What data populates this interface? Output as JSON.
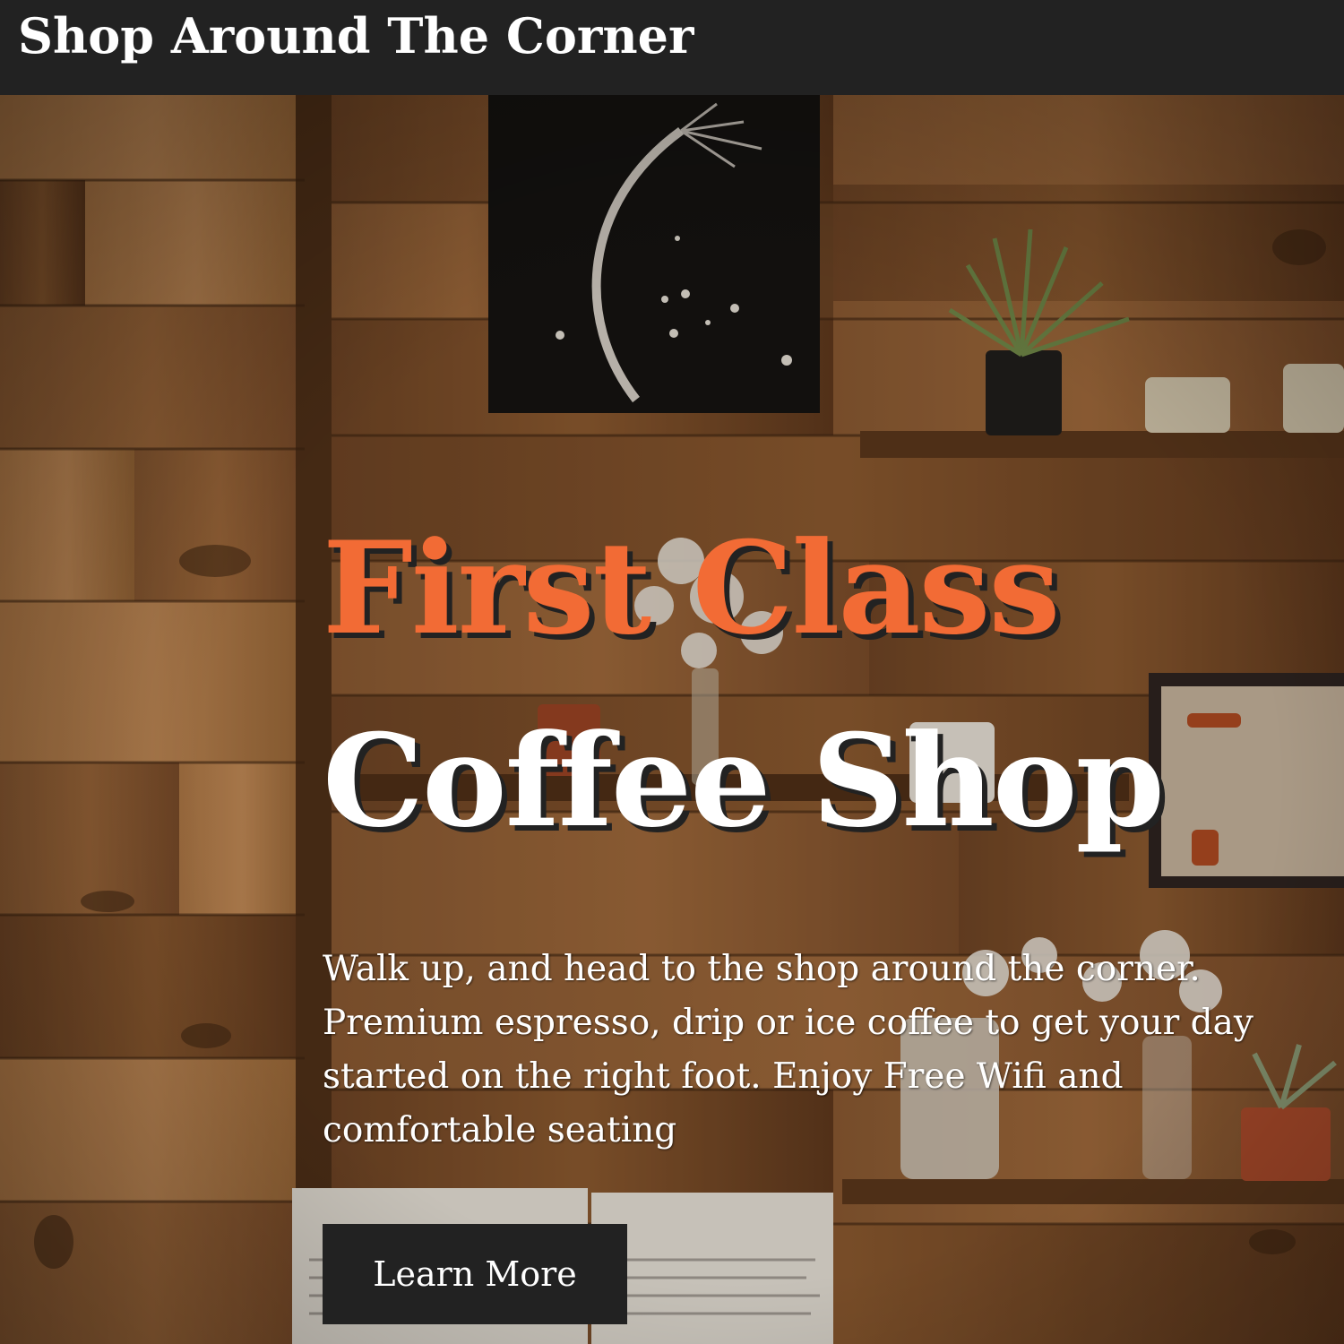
{
  "header": {
    "brand": "Shop Around The Corner"
  },
  "hero": {
    "headline_line1": "First Class",
    "headline_line2": "Coffee Shop",
    "description": "Walk up, and head to the shop around the corner. Premium espresso, drip or ice coffee to get your day started on the right foot. Enjoy Free Wifi and comfortable seating",
    "cta_label": "Learn More"
  },
  "colors": {
    "header_bg": "#222222",
    "accent": "#f26b35",
    "button_bg": "#222222",
    "text_light": "#ffffff"
  }
}
